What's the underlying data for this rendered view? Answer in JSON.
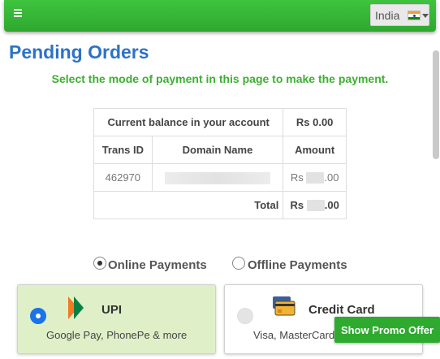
{
  "header": {
    "country": "India",
    "flag_icon": "india-flag-icon",
    "menu_icon": "hamburger-menu-icon",
    "bar_color": "#36b536"
  },
  "page": {
    "title": "Pending Orders",
    "instruction": "Select the mode of payment in this page to make the payment."
  },
  "orders": {
    "balance_label": "Current balance in your account",
    "balance_value": "Rs 0.00",
    "columns": [
      "Trans ID",
      "Domain Name",
      "Amount"
    ],
    "rows": [
      {
        "trans_id": "462970",
        "domain": "",
        "amount_prefix": "Rs",
        "amount_suffix": ".00"
      }
    ],
    "total_label": "Total",
    "total_prefix": "Rs",
    "total_suffix": ".00"
  },
  "payment_modes": {
    "online_label": "Online Payments",
    "offline_label": "Offline Payments",
    "selected": "online"
  },
  "methods": [
    {
      "title": "UPI",
      "description": "Google Pay, PhonePe & more",
      "selected": true,
      "icon": "upi-logo-icon"
    },
    {
      "title": "Credit Card",
      "description": "Visa, MasterCard",
      "selected": false,
      "icon": "credit-card-icon"
    }
  ],
  "promo": {
    "label": "Show Promo Offer"
  },
  "colors": {
    "title_blue": "#2d72c8",
    "instruction_green": "#3cb030",
    "selected_card_bg": "#dff0c8",
    "radio_blue": "#1a73e8",
    "promo_green": "#2eaa2e"
  }
}
